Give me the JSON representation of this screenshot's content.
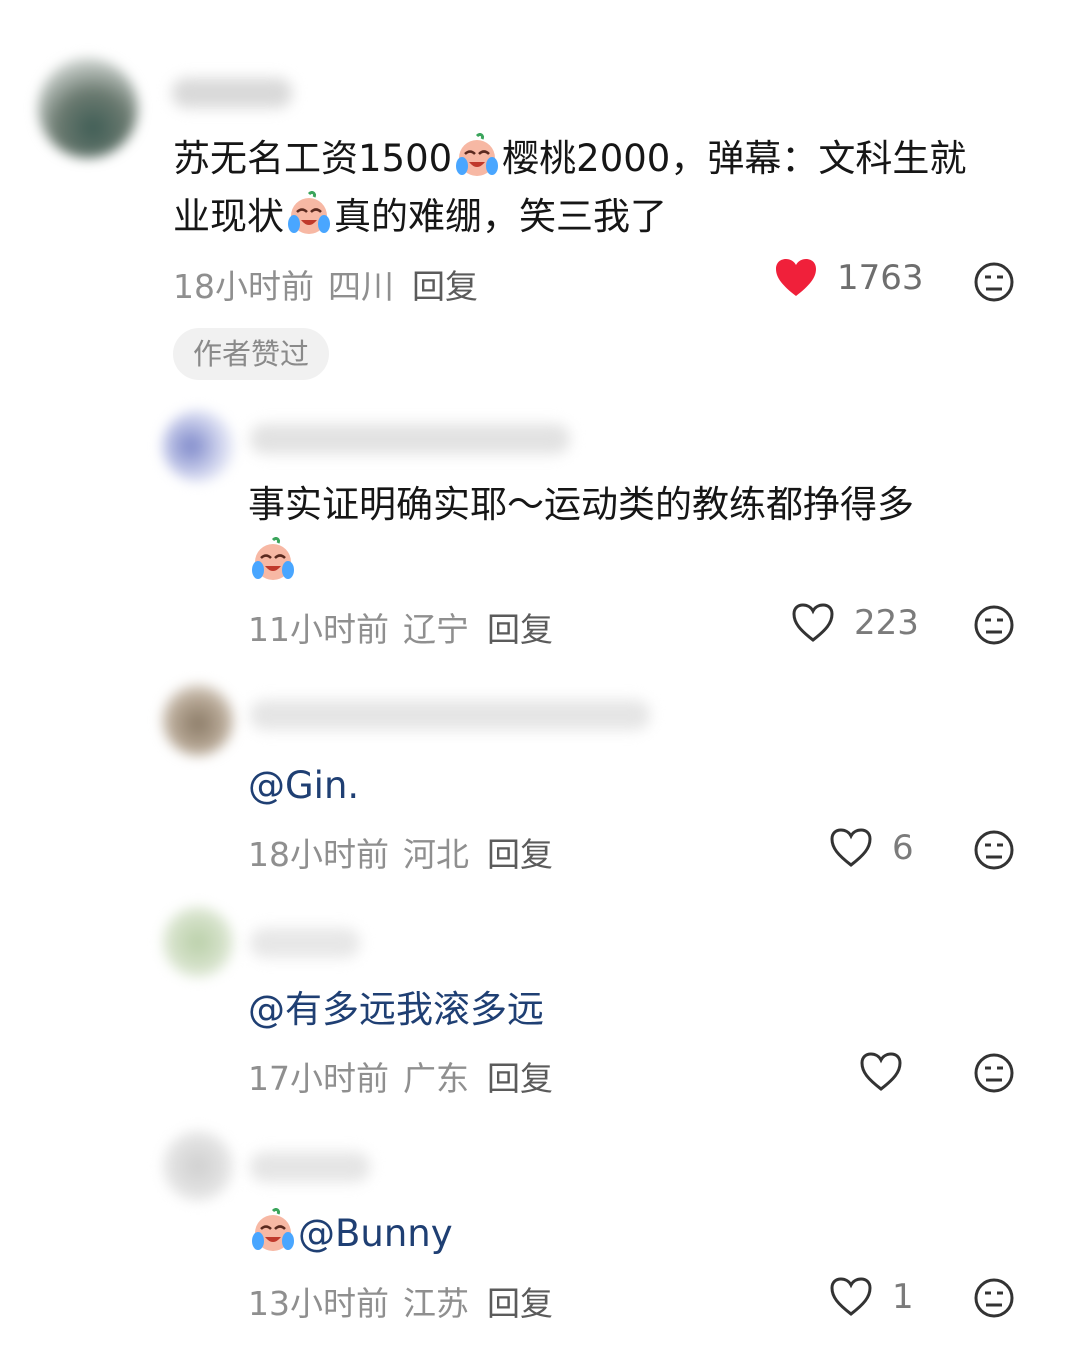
{
  "comments": [
    {
      "text_a": "苏无名工资1500",
      "text_b": "樱桃2000，弹幕：文科生就",
      "text_c": "业现状",
      "text_d": "真的难绷，笑三我了",
      "time": "18小时前",
      "region": "四川",
      "reply": "回复",
      "likes": "1763",
      "liked": true,
      "badge": "作者赞过"
    },
    {
      "text_a": "事实证明确实耶～运动类的教练都挣得多",
      "time": "11小时前",
      "region": "辽宁",
      "reply": "回复",
      "likes": "223",
      "liked": false
    },
    {
      "text_a": "@Gin.",
      "time": "18小时前",
      "region": "河北",
      "reply": "回复",
      "likes": "6",
      "liked": false
    },
    {
      "text_a": "@有多远我滚多远",
      "time": "17小时前",
      "region": "广东",
      "reply": "回复",
      "likes": "",
      "liked": false
    },
    {
      "text_a": "@Bunny",
      "time": "13小时前",
      "region": "江苏",
      "reply": "回复",
      "likes": "1",
      "liked": false
    }
  ],
  "colors": {
    "liked_red": "#f0203a",
    "mention_blue": "#1f3f73",
    "meta_gray": "#8f8f8f"
  },
  "icons": {
    "like": "heart-icon",
    "dislike": "neutral-face-icon",
    "emoji": "crying-laugh-emoji-icon"
  }
}
